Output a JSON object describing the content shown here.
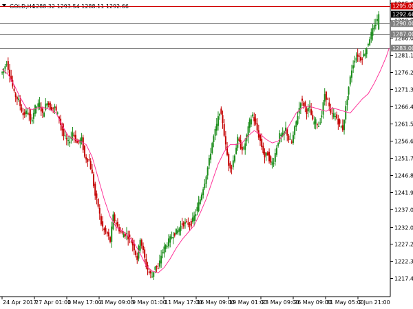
{
  "header": {
    "menu_icon": "triangle-down-icon",
    "symbol": "GOLD,H4",
    "ohlc": "1288.32 1293.54 1288.11 1292.66"
  },
  "colors": {
    "background": "#ffffff",
    "bull": "#1a8c1a",
    "bear": "#c40000",
    "ma": "#ff3399",
    "resistance": "#d00000",
    "level": "#808080",
    "price_badge": "#000000",
    "axis": "#000000"
  },
  "chart_data": {
    "type": "candlestick",
    "title": "",
    "xlabel": "",
    "ylabel": "",
    "ylim": [
      1212.4,
      1296.5
    ],
    "y_ticks": [
      1217.4,
      1222.3,
      1227.2,
      1232.0,
      1237.0,
      1241.9,
      1246.8,
      1251.7,
      1256.6,
      1261.5,
      1266.4,
      1271.3,
      1276.2,
      1281.1,
      1286.0,
      1290.9,
      1295.8
    ],
    "y_tick_labels": [
      "1217.40",
      "1222.30",
      "1227.20",
      "1232.00",
      "1237.00",
      "1241.90",
      "1246.80",
      "1251.70",
      "1256.60",
      "1261.50",
      "1266.40",
      "1271.30",
      "1276.20",
      "1281.10",
      "1286.00",
      "1290.90",
      "1295.80"
    ],
    "x_labels": [
      "24 Apr 2017",
      "27 Apr 01:00",
      "1 May 17:00",
      "4 May 09:00",
      "9 May 01:00",
      "11 May 17:00",
      "16 May 09:00",
      "19 May 01:00",
      "23 May 09:00",
      "26 May 09:00",
      "31 May 05:00",
      "2 Jun 21:00"
    ],
    "levels": [
      {
        "price": 1295.0,
        "label": "1295.00",
        "kind": "resistance"
      },
      {
        "price": 1290.0,
        "label": "1290.00",
        "kind": "level"
      },
      {
        "price": 1287.0,
        "label": "1287.00",
        "kind": "level"
      },
      {
        "price": 1283.0,
        "label": "1283.00",
        "kind": "level"
      }
    ],
    "current_price": {
      "price": 1292.66,
      "label": "1292.66"
    },
    "moving_average": [
      [
        0,
        1277.0
      ],
      [
        4,
        1275.5
      ],
      [
        8,
        1272.5
      ],
      [
        12,
        1269.0
      ],
      [
        16,
        1266.0
      ],
      [
        20,
        1265.5
      ],
      [
        24,
        1266.0
      ],
      [
        28,
        1266.0
      ],
      [
        32,
        1265.5
      ],
      [
        36,
        1264.5
      ],
      [
        40,
        1261.0
      ],
      [
        44,
        1258.0
      ],
      [
        48,
        1257.0
      ],
      [
        52,
        1256.5
      ],
      [
        56,
        1255.5
      ],
      [
        60,
        1252.0
      ],
      [
        64,
        1246.0
      ],
      [
        68,
        1240.0
      ],
      [
        72,
        1235.0
      ],
      [
        76,
        1232.0
      ],
      [
        80,
        1231.0
      ],
      [
        84,
        1229.5
      ],
      [
        88,
        1227.5
      ],
      [
        92,
        1224.5
      ],
      [
        96,
        1221.0
      ],
      [
        100,
        1219.5
      ],
      [
        104,
        1219.0
      ],
      [
        108,
        1220.5
      ],
      [
        112,
        1223.0
      ],
      [
        116,
        1226.0
      ],
      [
        120,
        1228.5
      ],
      [
        124,
        1230.5
      ],
      [
        128,
        1232.5
      ],
      [
        132,
        1236.0
      ],
      [
        136,
        1240.0
      ],
      [
        140,
        1245.0
      ],
      [
        144,
        1250.0
      ],
      [
        148,
        1253.5
      ],
      [
        152,
        1255.5
      ],
      [
        156,
        1255.5
      ],
      [
        160,
        1256.0
      ],
      [
        164,
        1258.0
      ],
      [
        168,
        1259.5
      ],
      [
        172,
        1258.5
      ],
      [
        176,
        1257.0
      ],
      [
        180,
        1256.0
      ],
      [
        184,
        1256.5
      ],
      [
        188,
        1258.5
      ],
      [
        192,
        1261.5
      ],
      [
        196,
        1264.5
      ],
      [
        200,
        1266.0
      ],
      [
        204,
        1266.5
      ],
      [
        208,
        1266.0
      ],
      [
        212,
        1265.5
      ],
      [
        216,
        1265.0
      ],
      [
        220,
        1266.0
      ],
      [
        224,
        1265.5
      ],
      [
        228,
        1265.0
      ],
      [
        232,
        1264.5
      ],
      [
        236,
        1266.5
      ],
      [
        240,
        1268.5
      ],
      [
        244,
        1270.0
      ],
      [
        248,
        1273.0
      ],
      [
        252,
        1276.5
      ],
      [
        256,
        1280.5
      ],
      [
        258,
        1283.0
      ]
    ],
    "price_path": [
      [
        0,
        1276
      ],
      [
        3,
        1279
      ],
      [
        6,
        1274
      ],
      [
        8,
        1270
      ],
      [
        11,
        1268
      ],
      [
        14,
        1264
      ],
      [
        17,
        1265
      ],
      [
        19,
        1262
      ],
      [
        22,
        1266
      ],
      [
        25,
        1267
      ],
      [
        27,
        1264
      ],
      [
        30,
        1268
      ],
      [
        32,
        1266
      ],
      [
        35,
        1266
      ],
      [
        38,
        1263
      ],
      [
        41,
        1258
      ],
      [
        44,
        1256
      ],
      [
        47,
        1259
      ],
      [
        50,
        1256
      ],
      [
        53,
        1257
      ],
      [
        55,
        1252
      ],
      [
        58,
        1251
      ],
      [
        60,
        1247
      ],
      [
        62,
        1241
      ],
      [
        64,
        1238
      ],
      [
        66,
        1233
      ],
      [
        68,
        1231
      ],
      [
        70,
        1230
      ],
      [
        72,
        1228
      ],
      [
        74,
        1235
      ],
      [
        77,
        1232
      ],
      [
        80,
        1230
      ],
      [
        83,
        1230
      ],
      [
        86,
        1228
      ],
      [
        88,
        1226
      ],
      [
        90,
        1223
      ],
      [
        92,
        1229
      ],
      [
        94,
        1225
      ],
      [
        96,
        1221
      ],
      [
        98,
        1219
      ],
      [
        100,
        1218
      ],
      [
        102,
        1221
      ],
      [
        104,
        1220
      ],
      [
        106,
        1224
      ],
      [
        108,
        1226
      ],
      [
        111,
        1228
      ],
      [
        114,
        1230
      ],
      [
        117,
        1231
      ],
      [
        120,
        1233
      ],
      [
        123,
        1233
      ],
      [
        126,
        1233
      ],
      [
        129,
        1236
      ],
      [
        132,
        1240
      ],
      [
        135,
        1245
      ],
      [
        138,
        1251
      ],
      [
        140,
        1256
      ],
      [
        143,
        1261
      ],
      [
        145,
        1265
      ],
      [
        147,
        1262
      ],
      [
        149,
        1255
      ],
      [
        151,
        1250
      ],
      [
        153,
        1249
      ],
      [
        155,
        1253
      ],
      [
        157,
        1257
      ],
      [
        159,
        1255
      ],
      [
        161,
        1254
      ],
      [
        163,
        1258
      ],
      [
        165,
        1262
      ],
      [
        167,
        1264
      ],
      [
        169,
        1261
      ],
      [
        171,
        1258
      ],
      [
        173,
        1255
      ],
      [
        175,
        1252
      ],
      [
        177,
        1253
      ],
      [
        179,
        1250
      ],
      [
        181,
        1251
      ],
      [
        183,
        1255
      ],
      [
        185,
        1258
      ],
      [
        187,
        1258
      ],
      [
        189,
        1260
      ],
      [
        191,
        1257
      ],
      [
        193,
        1256
      ],
      [
        195,
        1260
      ],
      [
        197,
        1264
      ],
      [
        199,
        1268
      ],
      [
        201,
        1267
      ],
      [
        203,
        1265
      ],
      [
        205,
        1266
      ],
      [
        207,
        1262
      ],
      [
        209,
        1262
      ],
      [
        211,
        1261
      ],
      [
        213,
        1264
      ],
      [
        215,
        1270
      ],
      [
        217,
        1268
      ],
      [
        219,
        1264
      ],
      [
        221,
        1264
      ],
      [
        223,
        1263
      ],
      [
        225,
        1261
      ],
      [
        227,
        1260
      ],
      [
        229,
        1266
      ],
      [
        231,
        1272
      ],
      [
        233,
        1277
      ],
      [
        235,
        1280
      ],
      [
        237,
        1281
      ],
      [
        239,
        1280
      ],
      [
        241,
        1281
      ],
      [
        243,
        1283
      ],
      [
        245,
        1286
      ],
      [
        247,
        1288
      ],
      [
        249,
        1290
      ],
      [
        251,
        1293
      ]
    ]
  }
}
